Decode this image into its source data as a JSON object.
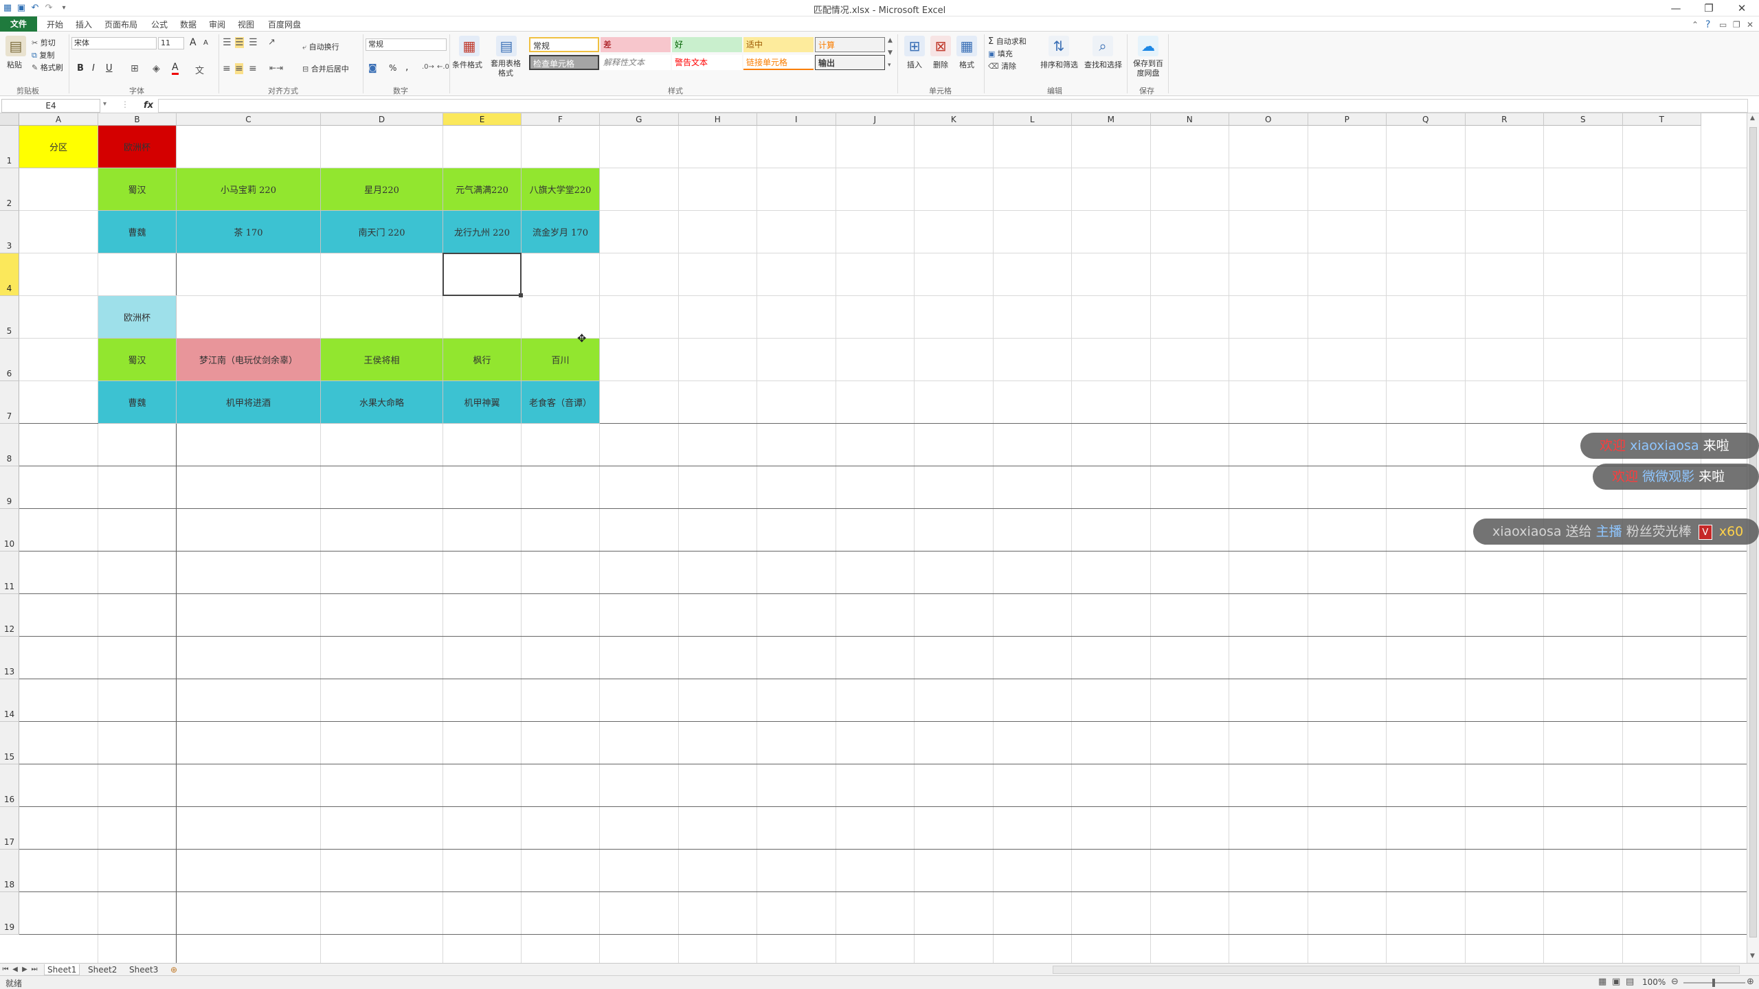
{
  "window": {
    "title": "匹配情况.xlsx - Microsoft Excel",
    "min_glyph": "—",
    "restore_glyph": "❐",
    "close_glyph": "✕"
  },
  "menu": {
    "file": "文件",
    "tabs": [
      "开始",
      "插入",
      "页面布局",
      "公式",
      "数据",
      "审阅",
      "视图",
      "百度网盘"
    ]
  },
  "ribbon": {
    "clipboard": {
      "paste": "粘贴",
      "cut": "剪切",
      "copy": "复制",
      "format_painter": "格式刷",
      "label": "剪贴板"
    },
    "font": {
      "name": "宋体",
      "size": "11",
      "grow": "A",
      "shrink": "A",
      "bold": "B",
      "italic": "I",
      "underline": "U",
      "label": "字体"
    },
    "alignment": {
      "wrap": "自动换行",
      "merge": "合并后居中",
      "label": "对齐方式"
    },
    "number": {
      "format": "常规",
      "percent": "%",
      "comma": ",",
      "label": "数字"
    },
    "styles": {
      "conditional": "条件格式",
      "table": "套用表格格式",
      "label": "样式",
      "cells": [
        {
          "text": "常规",
          "bg": "#ffffff",
          "fg": "#333333"
        },
        {
          "text": "差",
          "bg": "#f7c6cc",
          "fg": "#9c0006"
        },
        {
          "text": "好",
          "bg": "#c9efcd",
          "fg": "#006100"
        },
        {
          "text": "适中",
          "bg": "#fdeb9c",
          "fg": "#9c5700"
        },
        {
          "text": "计算",
          "bg": "#f2f2f2",
          "fg": "#fa7d00"
        },
        {
          "text": "检查单元格",
          "bg": "#a5a5a5",
          "fg": "#ffffff"
        },
        {
          "text": "解释性文本",
          "bg": "#ffffff",
          "fg": "#7f7f7f"
        },
        {
          "text": "警告文本",
          "bg": "#ffffff",
          "fg": "#ff0000"
        },
        {
          "text": "链接单元格",
          "bg": "#ffffff",
          "fg": "#fa7d00"
        },
        {
          "text": "输出",
          "bg": "#f2f2f2",
          "fg": "#3f3f3f"
        }
      ]
    },
    "cells": {
      "insert": "插入",
      "delete": "删除",
      "format": "格式",
      "label": "单元格"
    },
    "editing": {
      "autosum": "自动求和",
      "fill": "填充",
      "clear": "清除",
      "sort": "排序和筛选",
      "find": "查找和选择",
      "label": "编辑"
    },
    "save": {
      "btn": "保存到百度网盘",
      "label": "保存"
    }
  },
  "formula_bar": {
    "name_box": "E4",
    "fx": "fx",
    "value": ""
  },
  "grid": {
    "columns": [
      "A",
      "B",
      "C",
      "D",
      "E",
      "F",
      "G",
      "H",
      "I",
      "J",
      "K",
      "L",
      "M",
      "N",
      "O",
      "P",
      "Q",
      "R",
      "S",
      "T"
    ],
    "rows": [
      "1",
      "2",
      "3",
      "4",
      "5",
      "6",
      "7",
      "8",
      "9",
      "10",
      "11",
      "12",
      "13",
      "14",
      "15",
      "16",
      "17",
      "18",
      "19"
    ],
    "active_col": "E",
    "active_row": "4"
  },
  "cells": [
    {
      "ref": "A1",
      "text": "分区",
      "bg": "#ffff00"
    },
    {
      "ref": "B1",
      "text": "欧洲杯",
      "bg": "#d40000"
    },
    {
      "ref": "B2",
      "text": "蜀汉",
      "bg": "#92e62f"
    },
    {
      "ref": "C2",
      "text": "小马宝莉 220",
      "bg": "#92e62f"
    },
    {
      "ref": "D2",
      "text": "星月220",
      "bg": "#92e62f"
    },
    {
      "ref": "E2",
      "text": "元气满满220",
      "bg": "#92e62f"
    },
    {
      "ref": "F2",
      "text": "八旗大学堂220",
      "bg": "#92e62f"
    },
    {
      "ref": "B3",
      "text": "曹魏",
      "bg": "#3cc2d2"
    },
    {
      "ref": "C3",
      "text": "茶    170",
      "bg": "#3cc2d2"
    },
    {
      "ref": "D3",
      "text": "南天门    220",
      "bg": "#3cc2d2"
    },
    {
      "ref": "E3",
      "text": "龙行九州 220",
      "bg": "#3cc2d2"
    },
    {
      "ref": "F3",
      "text": "流金岁月    170",
      "bg": "#3cc2d2"
    },
    {
      "ref": "B5",
      "text": "欧洲杯",
      "bg": "#9ee0ea"
    },
    {
      "ref": "B6",
      "text": "蜀汉",
      "bg": "#92e62f"
    },
    {
      "ref": "C6",
      "text": "梦江南（电玩仗剑余辜）",
      "bg": "#e8959a"
    },
    {
      "ref": "D6",
      "text": "王侯将相",
      "bg": "#92e62f"
    },
    {
      "ref": "E6",
      "text": "枫行",
      "bg": "#92e62f"
    },
    {
      "ref": "F6",
      "text": "百川",
      "bg": "#92e62f"
    },
    {
      "ref": "B7",
      "text": "曹魏",
      "bg": "#3cc2d2"
    },
    {
      "ref": "C7",
      "text": "机甲将进酒",
      "bg": "#3cc2d2"
    },
    {
      "ref": "D7",
      "text": "水果大命略",
      "bg": "#3cc2d2"
    },
    {
      "ref": "E7",
      "text": "机甲神翼",
      "bg": "#3cc2d2"
    },
    {
      "ref": "F7",
      "text": "老食客（音谭）",
      "bg": "#3cc2d2"
    }
  ],
  "sheets": [
    "Sheet1",
    "Sheet2",
    "Sheet3"
  ],
  "status": {
    "ready": "就绪",
    "zoom": "100%"
  },
  "danmaku": [
    {
      "prefix": "欢迎",
      "user": "xiaoxiaosa",
      "suffix": "来啦"
    },
    {
      "prefix": "欢迎",
      "user": "微微观影",
      "suffix": "来啦"
    },
    {
      "user": "xiaoxiaosa",
      "action": "送给",
      "target": "主播",
      "gift": "粉丝荧光棒",
      "badge": "V",
      "count": "x60"
    }
  ]
}
